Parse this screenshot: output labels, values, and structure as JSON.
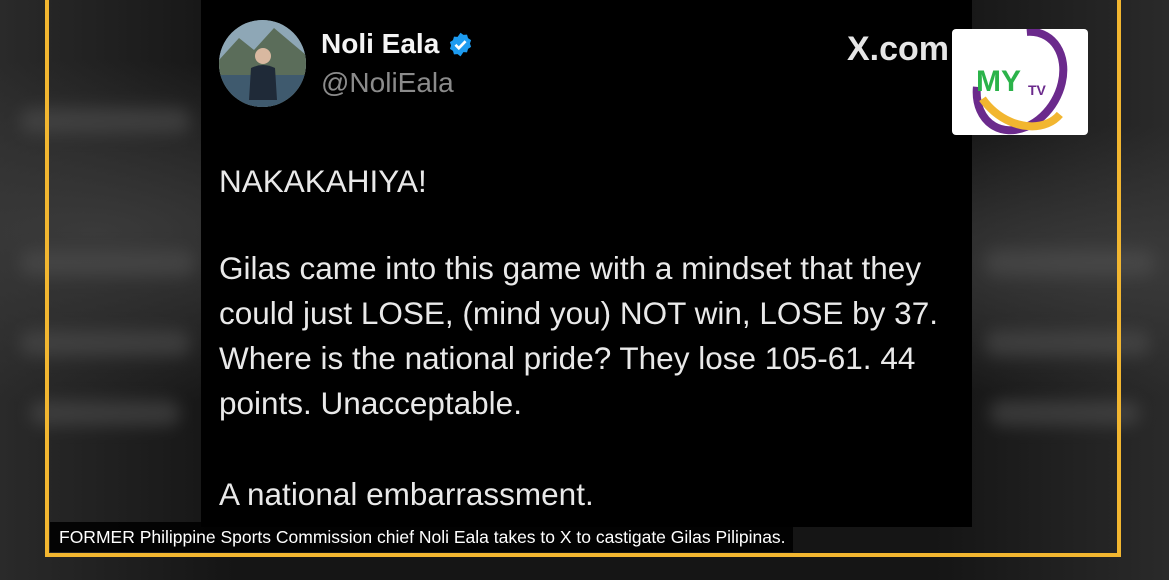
{
  "tweet": {
    "display_name": "Noli Eala",
    "handle": "@NoliEala",
    "source": "X.com",
    "lines": [
      "NAKAKAHIYA!",
      "Gilas came into this game with a mindset that they",
      "could just LOSE, (mind you) NOT win, LOSE by 37.",
      "Where is the national pride? They lose 105-61. 44",
      "points. Unacceptable.",
      "A national embarrassment."
    ]
  },
  "logo": {
    "text": "MYTV"
  },
  "caption": "FORMER Philippine Sports Commission chief Noli Eala takes to X to castigate Gilas Pilipinas.",
  "colors": {
    "frame": "#f2b630",
    "logo_purple": "#6b2a8c",
    "logo_green": "#2bb34a",
    "logo_yellow": "#f2b630",
    "verified": "#1d9bf0"
  }
}
